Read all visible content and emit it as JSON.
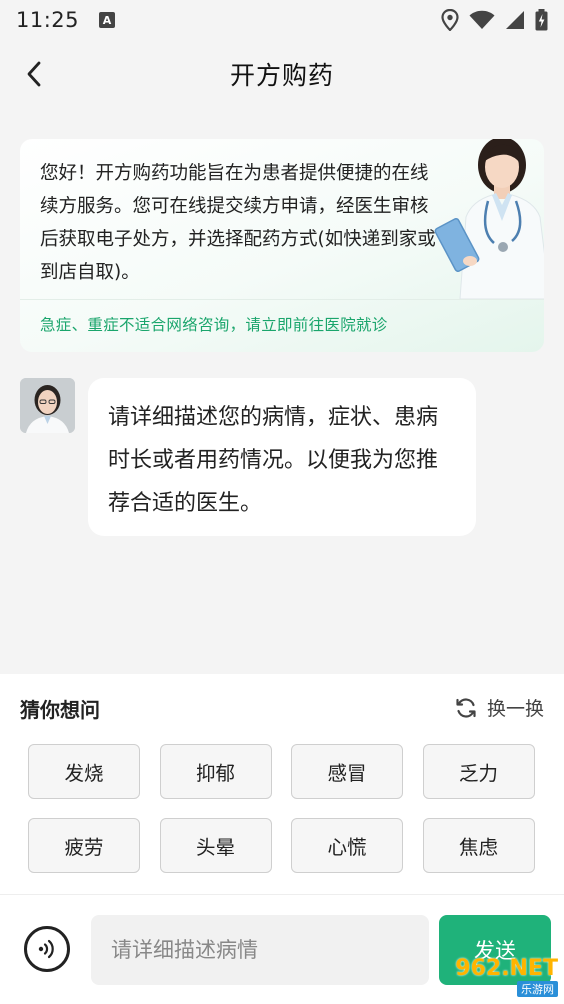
{
  "status_bar": {
    "time": "11:25",
    "notification_icon": "a-icon",
    "icons": [
      "location-icon",
      "wifi-icon",
      "signal-icon",
      "battery-icon"
    ]
  },
  "header": {
    "title": "开方购药",
    "back_icon": "chevron-left-icon"
  },
  "intro": {
    "text": "您好！开方购药功能旨在为患者提供便捷的在线续方服务。您可在线提交续方申请，经医生审核后获取电子处方，并选择配药方式(如快递到家或到店自取)。",
    "warning": "急症、重症不适合网络咨询，请立即前往医院就诊"
  },
  "chat": {
    "message": "请详细描述您的病情，症状、患病时长或者用药情况。以便我为您推荐合适的医生。"
  },
  "suggestions": {
    "title": "猜你想问",
    "refresh_label": "换一换",
    "chips": [
      "发烧",
      "抑郁",
      "感冒",
      "乏力",
      "疲劳",
      "头晕",
      "心慌",
      "焦虑"
    ]
  },
  "input_bar": {
    "placeholder": "请详细描述病情",
    "send_label": "发送"
  },
  "watermark": {
    "big": "962.NET",
    "small": "乐游网"
  },
  "colors": {
    "accent": "#1fb27a",
    "warning_text": "#1aa56c",
    "background": "#f4f4f4"
  }
}
